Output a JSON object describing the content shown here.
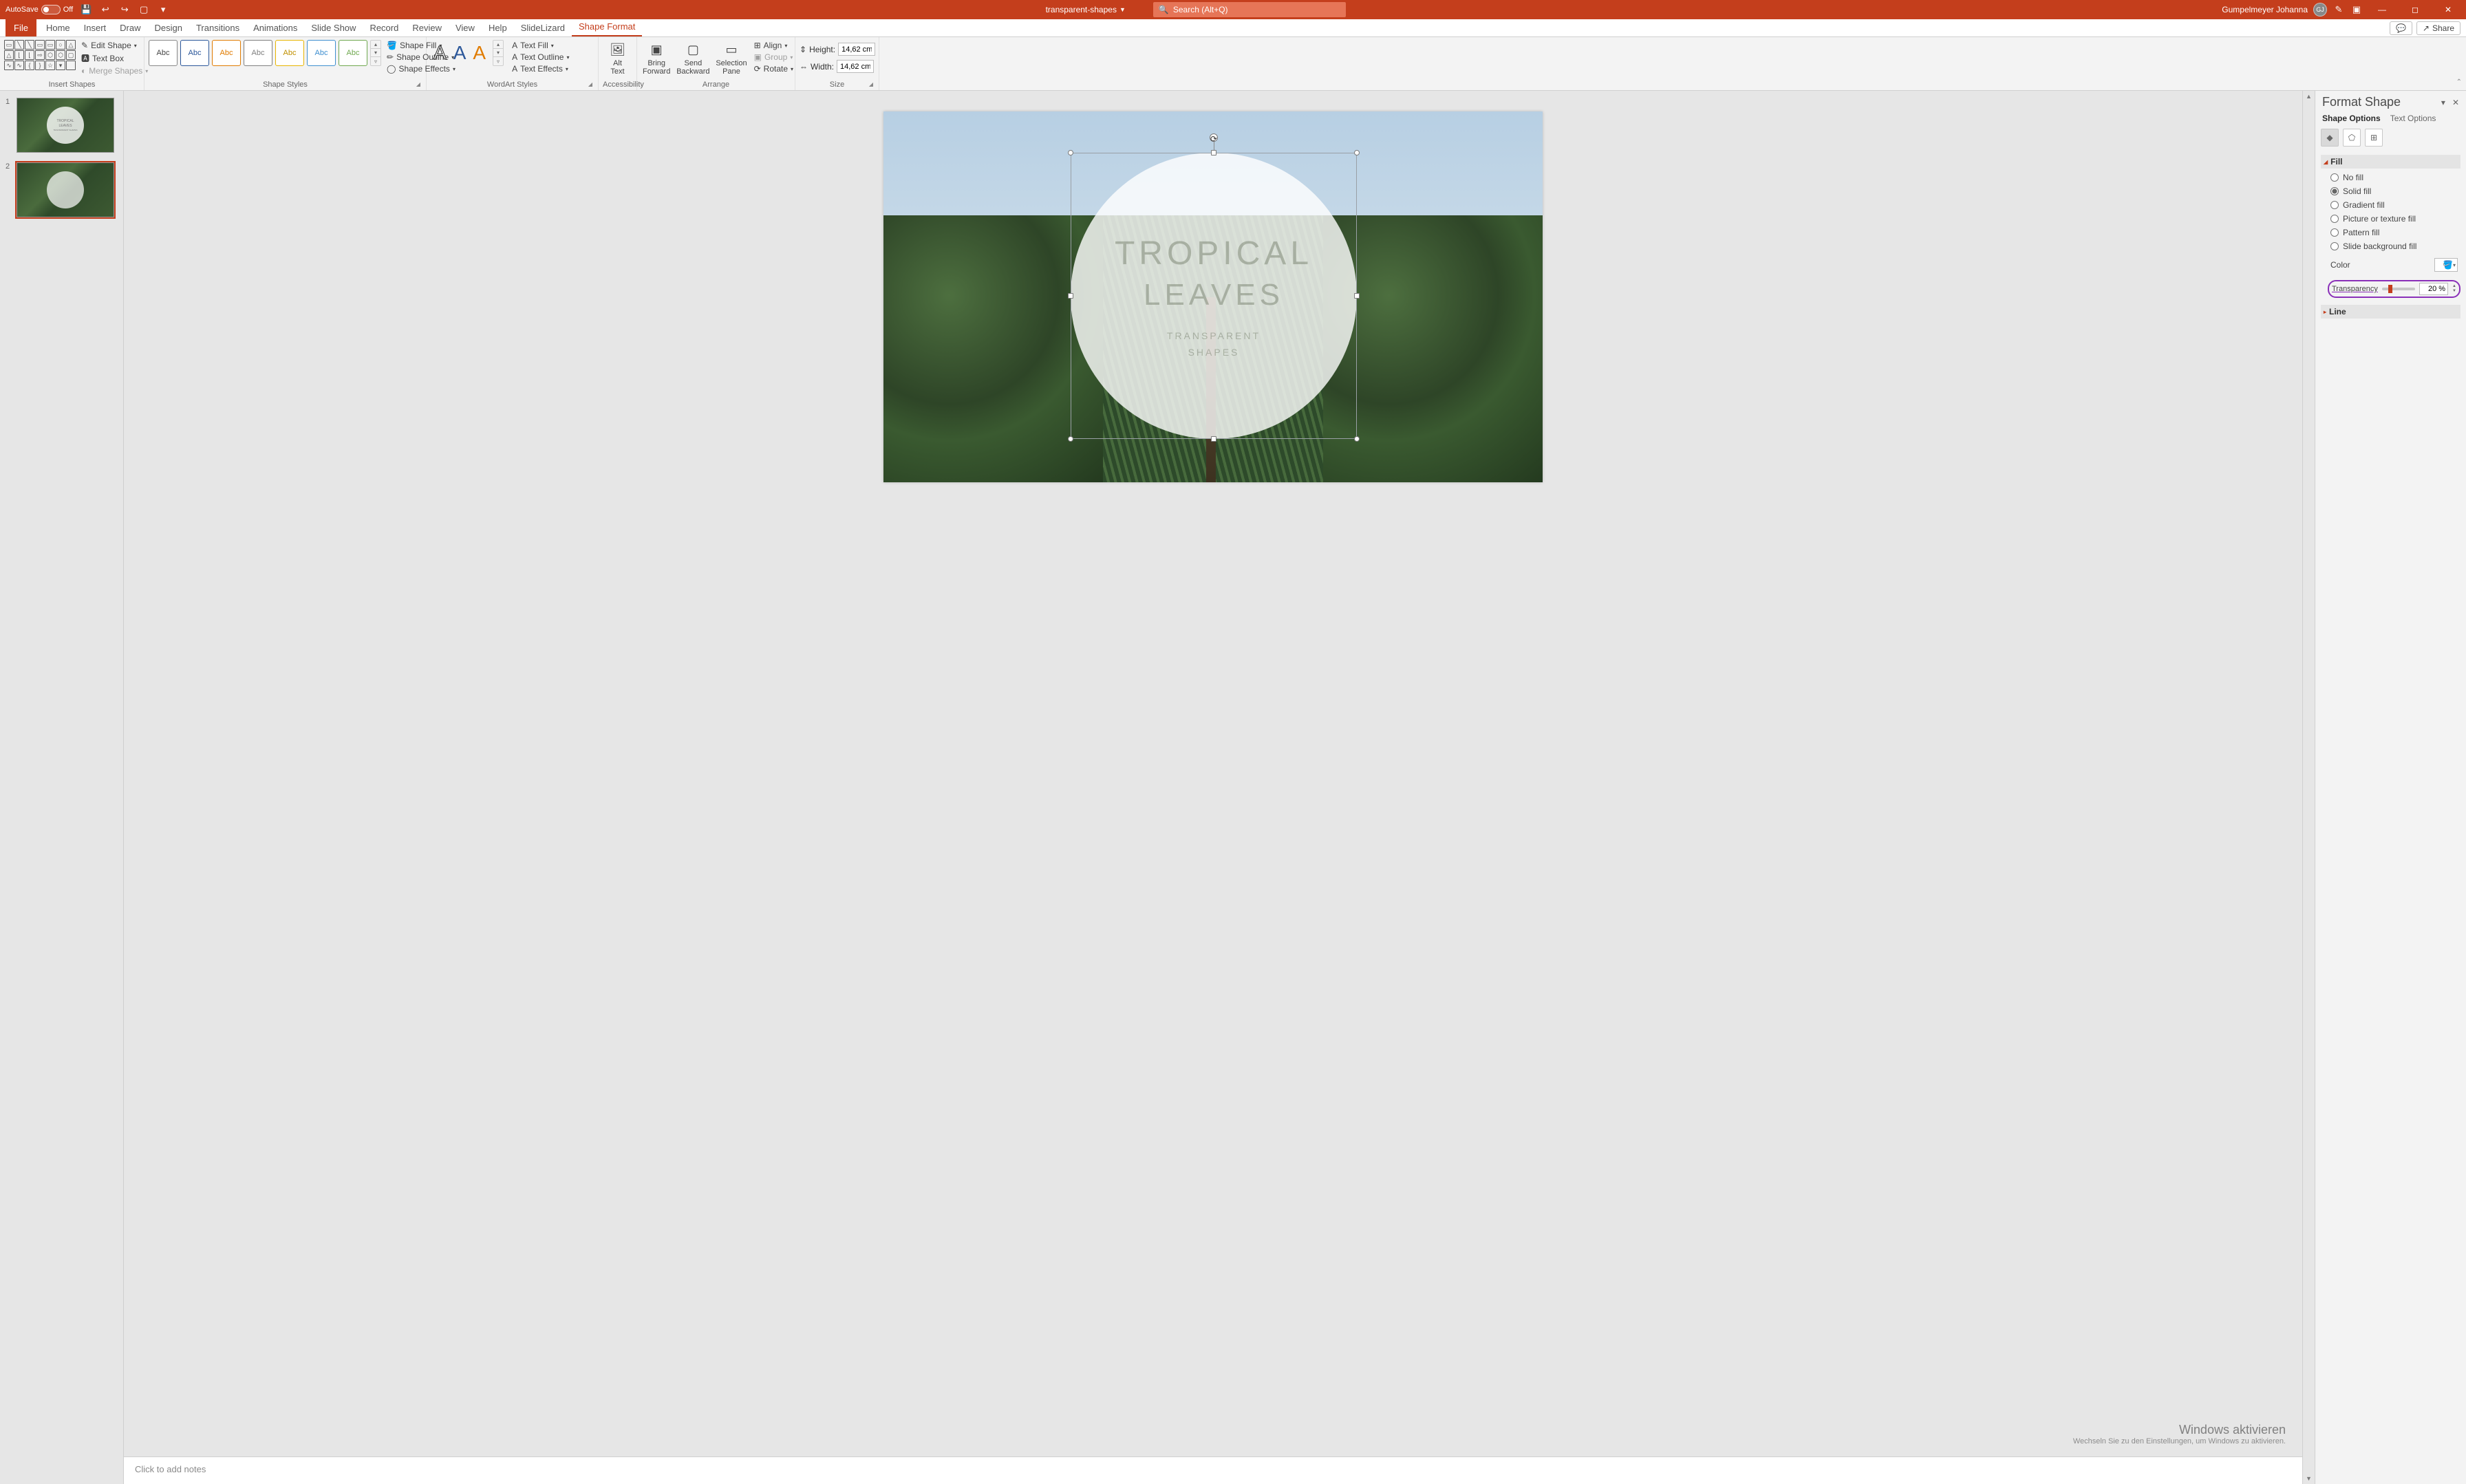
{
  "titlebar": {
    "autosave_label": "AutoSave",
    "autosave_state": "Off",
    "filename": "transparent-shapes",
    "search_placeholder": "Search (Alt+Q)",
    "user_name": "Gumpelmeyer Johanna",
    "user_initials": "GJ"
  },
  "tabs": {
    "file": "File",
    "items": [
      "Home",
      "Insert",
      "Draw",
      "Design",
      "Transitions",
      "Animations",
      "Slide Show",
      "Record",
      "Review",
      "View",
      "Help",
      "SlideLizard",
      "Shape Format"
    ],
    "active": "Shape Format",
    "comments_aria": "Comments",
    "share": "Share"
  },
  "ribbon": {
    "insert_shapes": {
      "edit_shape": "Edit Shape",
      "text_box": "Text Box",
      "merge_shapes": "Merge Shapes",
      "label": "Insert Shapes"
    },
    "shape_styles": {
      "sample": "Abc",
      "fill": "Shape Fill",
      "outline": "Shape Outline",
      "effects": "Shape Effects",
      "label": "Shape Styles"
    },
    "wordart": {
      "glyph": "A",
      "text_fill": "Text Fill",
      "text_outline": "Text Outline",
      "text_effects": "Text Effects",
      "label": "WordArt Styles"
    },
    "accessibility": {
      "alt_text": "Alt\nText",
      "label": "Accessibility"
    },
    "arrange": {
      "bring_forward": "Bring\nForward",
      "send_backward": "Send\nBackward",
      "selection_pane": "Selection\nPane",
      "align": "Align",
      "group": "Group",
      "rotate": "Rotate",
      "label": "Arrange"
    },
    "size": {
      "height_label": "Height:",
      "height_value": "14,62 cm",
      "width_label": "Width:",
      "width_value": "14,62 cm",
      "label": "Size"
    }
  },
  "thumbnails": [
    {
      "num": "1",
      "title1": "TROPICAL",
      "title2": "LEAVES",
      "sub": "TRANSPARENT SHAPES"
    },
    {
      "num": "2"
    }
  ],
  "slide": {
    "line1": "TROPICAL",
    "line2": "LEAVES",
    "line3": "TRANSPARENT",
    "line4": "SHAPES"
  },
  "watermark": {
    "line1": "Windows aktivieren",
    "line2": "Wechseln Sie zu den Einstellungen, um Windows zu aktivieren."
  },
  "notes_placeholder": "Click to add notes",
  "pane": {
    "title": "Format Shape",
    "shape_options": "Shape Options",
    "text_options": "Text Options",
    "fill_header": "Fill",
    "options": {
      "no_fill": "No fill",
      "solid_fill": "Solid fill",
      "gradient_fill": "Gradient fill",
      "picture_fill": "Picture or texture fill",
      "pattern_fill": "Pattern fill",
      "slide_bg_fill": "Slide background fill"
    },
    "color_label": "Color",
    "transparency_label": "Transparency",
    "transparency_value": "20 %",
    "line_header": "Line"
  }
}
